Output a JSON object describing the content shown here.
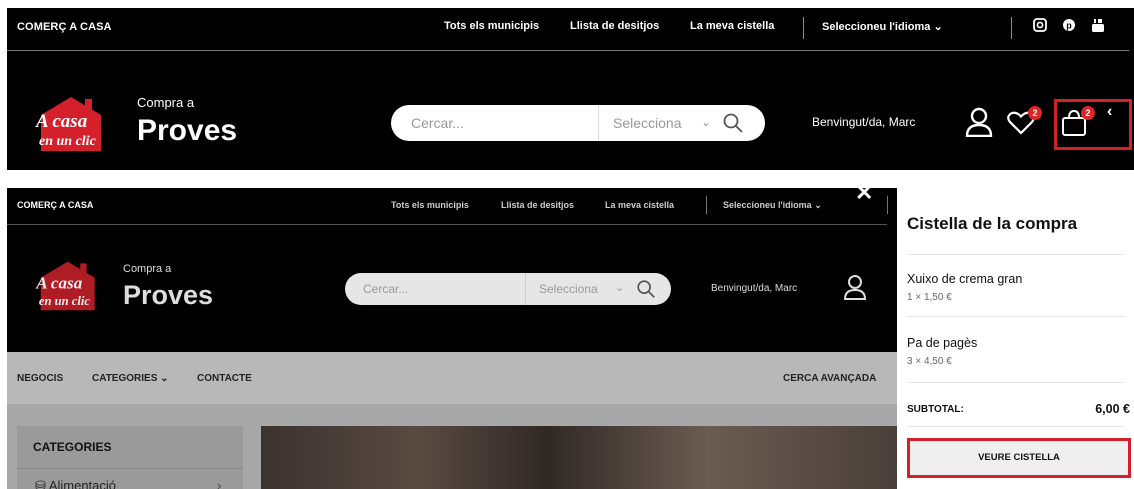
{
  "colors": {
    "highlight": "#d4202a",
    "badge": "#e02424",
    "header_bg": "#000000"
  },
  "header": {
    "brand": "COMERÇ A CASA",
    "nav": [
      "Tots els municipis",
      "Llista de desitjos",
      "La meva cistella"
    ],
    "language": "Seleccioneu l'idioma",
    "social_icons": [
      "instagram-icon",
      "pinterest-icon",
      "youtube-icon"
    ]
  },
  "site": {
    "logo_line1": "A casa",
    "logo_line2": "en un clic",
    "tagline": "Compra a",
    "name": "Proves"
  },
  "search": {
    "placeholder": "Cercar...",
    "category": "Selecciona"
  },
  "user": {
    "welcome": "Benvingut/da, Marc"
  },
  "badges": {
    "wishlist": "2",
    "cart": "2"
  },
  "menu": {
    "items": [
      "NEGOCIS",
      "CATEGORIES",
      "CONTACTE"
    ],
    "advanced": "CERCA AVANÇADA"
  },
  "sidebar": {
    "title": "CATEGORIES",
    "first_item": "Alimentació"
  },
  "cart": {
    "title": "Cistella de la compra",
    "items": [
      {
        "name": "Xuixo de crema gran",
        "qty": "1 × 1,50 €"
      },
      {
        "name": "Pa de pagès",
        "qty": "3 × 4,50 €"
      }
    ],
    "subtotal_label": "SUBTOTAL:",
    "subtotal_value": "6,00 €",
    "view_button": "VEURE CISTELLA"
  }
}
